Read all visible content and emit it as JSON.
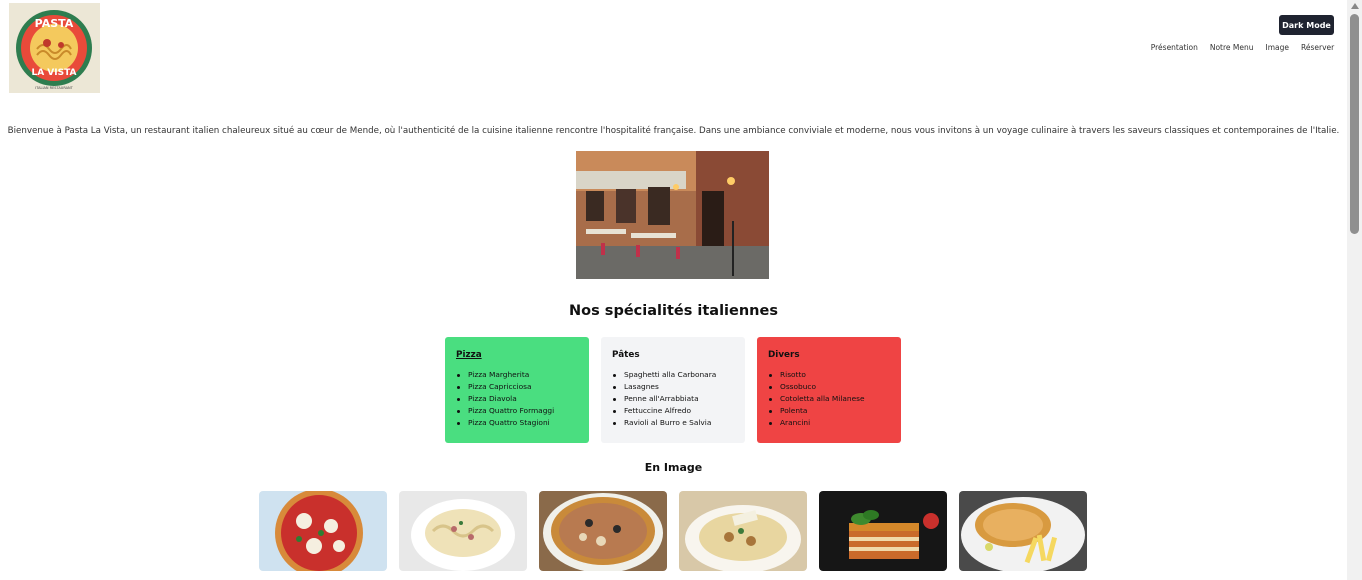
{
  "header": {
    "logo_text_top": "PASTA",
    "logo_text_bottom": "LA VISTA",
    "logo_caption": "ITALIAN RESTAURANT",
    "dark_mode_label": "Dark Mode",
    "nav": [
      "Présentation",
      "Notre Menu",
      "Image",
      "Réserver !"
    ]
  },
  "intro": "Bienvenue à Pasta La Vista, un restaurant italien chaleureux situé au cœur de Mende, où l'authenticité de la cuisine italienne rencontre l'hospitalité française. Dans une ambiance conviviale et moderne, nous vous invitons à un voyage culinaire à travers les saveurs classiques et contemporaines de l'Italie.",
  "specialties": {
    "title": "Nos spécialités italiennes",
    "cards": [
      {
        "title": "Pizza",
        "color": "#4ade80",
        "items": [
          "Pizza Margherita",
          "Pizza Capricciosa",
          "Pizza Diavola",
          "Pizza Quattro Formaggi",
          "Pizza Quattro Stagioni"
        ]
      },
      {
        "title": "Pâtes",
        "color": "#f3f4f6",
        "items": [
          "Spaghetti alla Carbonara",
          "Lasagnes",
          "Penne all'Arrabbiata",
          "Fettuccine Alfredo",
          "Ravioli al Burro e Salvia"
        ]
      },
      {
        "title": "Divers",
        "color": "#ef4444",
        "items": [
          "Risotto",
          "Ossobuco",
          "Cotoletta alla Milanese",
          "Polenta",
          "Arancini"
        ]
      }
    ]
  },
  "gallery": {
    "title": "En Image",
    "images": [
      "pizza-photo",
      "carbonara-photo",
      "pizza-mushroom-photo",
      "risotto-photo",
      "lasagna-photo",
      "cotoletta-photo"
    ]
  },
  "colors": {
    "dark_button": "#1f2330",
    "pizza_card": "#4ade80",
    "pates_card": "#f3f4f6",
    "divers_card": "#ef4444"
  }
}
